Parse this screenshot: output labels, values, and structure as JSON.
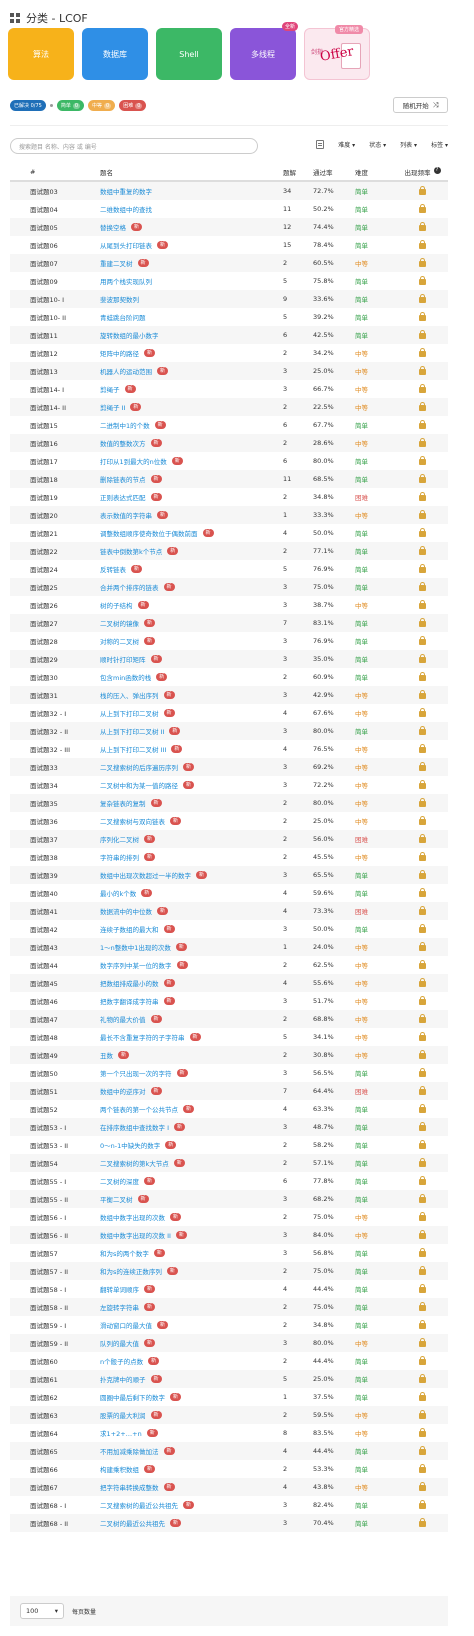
{
  "header": {
    "title": "分类 - LCOF"
  },
  "cards": [
    {
      "label": "算法",
      "color": "#f7b21a",
      "badge": ""
    },
    {
      "label": "数据库",
      "color": "#2f8fe6",
      "badge": ""
    },
    {
      "label": "Shell",
      "color": "#3cb866",
      "badge": ""
    },
    {
      "label": "多线程",
      "color": "#8a55d9",
      "badge": "全新"
    }
  ],
  "offer_card": {
    "tag": "官方精选",
    "text": "Offer",
    "sub": "剑指"
  },
  "status": {
    "solved": {
      "label": "已解决 0/75",
      "color": "#1f6fb8"
    },
    "easy": {
      "label": "简单",
      "count": "0",
      "color": "#3cb866"
    },
    "medium": {
      "label": "中等",
      "count": "0",
      "color": "#f0ad4e"
    },
    "hard": {
      "label": "困难",
      "count": "0",
      "color": "#d9534f"
    }
  },
  "random_button": {
    "label": "随机开始",
    "icon": "shuffle-icon"
  },
  "search": {
    "placeholder": "搜索题目 名称、内容 或 编号"
  },
  "filters": [
    "难度",
    "状态",
    "列表",
    "标签"
  ],
  "columns": {
    "num": "#",
    "title": "题名",
    "solutions": "题解",
    "acceptance": "通过率",
    "difficulty": "难度",
    "frequency": "出现频率"
  },
  "new_badge": "新",
  "rows": [
    {
      "id": "面试题03",
      "title": "数组中重复的数字",
      "new": false,
      "sol": "34",
      "rate": "72.7%",
      "diff": "简单"
    },
    {
      "id": "面试题04",
      "title": "二维数组中的查找",
      "new": false,
      "sol": "11",
      "rate": "50.2%",
      "diff": "简单"
    },
    {
      "id": "面试题05",
      "title": "替换空格",
      "new": true,
      "sol": "12",
      "rate": "74.4%",
      "diff": "简单"
    },
    {
      "id": "面试题06",
      "title": "从尾到头打印链表",
      "new": true,
      "sol": "15",
      "rate": "78.4%",
      "diff": "简单"
    },
    {
      "id": "面试题07",
      "title": "重建二叉树",
      "new": true,
      "sol": "2",
      "rate": "60.5%",
      "diff": "中等"
    },
    {
      "id": "面试题09",
      "title": "用两个栈实现队列",
      "new": false,
      "sol": "5",
      "rate": "75.8%",
      "diff": "简单"
    },
    {
      "id": "面试题10- I",
      "title": "斐波那契数列",
      "new": false,
      "sol": "9",
      "rate": "33.6%",
      "diff": "简单"
    },
    {
      "id": "面试题10- II",
      "title": "青蛙跳台阶问题",
      "new": false,
      "sol": "5",
      "rate": "39.2%",
      "diff": "简单"
    },
    {
      "id": "面试题11",
      "title": "旋转数组的最小数字",
      "new": false,
      "sol": "6",
      "rate": "42.5%",
      "diff": "简单"
    },
    {
      "id": "面试题12",
      "title": "矩阵中的路径",
      "new": true,
      "sol": "2",
      "rate": "34.2%",
      "diff": "中等"
    },
    {
      "id": "面试题13",
      "title": "机器人的运动范围",
      "new": true,
      "sol": "3",
      "rate": "25.0%",
      "diff": "中等"
    },
    {
      "id": "面试题14- I",
      "title": "剪绳子",
      "new": true,
      "sol": "3",
      "rate": "66.7%",
      "diff": "中等"
    },
    {
      "id": "面试题14- II",
      "title": "剪绳子 II",
      "new": true,
      "sol": "2",
      "rate": "22.5%",
      "diff": "中等"
    },
    {
      "id": "面试题15",
      "title": "二进制中1的个数",
      "new": true,
      "sol": "6",
      "rate": "67.7%",
      "diff": "简单"
    },
    {
      "id": "面试题16",
      "title": "数值的整数次方",
      "new": true,
      "sol": "2",
      "rate": "28.6%",
      "diff": "中等"
    },
    {
      "id": "面试题17",
      "title": "打印从1到最大的n位数",
      "new": true,
      "sol": "6",
      "rate": "80.0%",
      "diff": "简单"
    },
    {
      "id": "面试题18",
      "title": "删除链表的节点",
      "new": true,
      "sol": "11",
      "rate": "68.5%",
      "diff": "简单"
    },
    {
      "id": "面试题19",
      "title": "正则表达式匹配",
      "new": true,
      "sol": "2",
      "rate": "34.8%",
      "diff": "困难"
    },
    {
      "id": "面试题20",
      "title": "表示数值的字符串",
      "new": true,
      "sol": "1",
      "rate": "33.3%",
      "diff": "中等"
    },
    {
      "id": "面试题21",
      "title": "调整数组顺序使奇数位于偶数前面",
      "new": true,
      "sol": "4",
      "rate": "50.0%",
      "diff": "简单"
    },
    {
      "id": "面试题22",
      "title": "链表中倒数第k个节点",
      "new": true,
      "sol": "2",
      "rate": "77.1%",
      "diff": "简单"
    },
    {
      "id": "面试题24",
      "title": "反转链表",
      "new": true,
      "sol": "5",
      "rate": "76.9%",
      "diff": "简单"
    },
    {
      "id": "面试题25",
      "title": "合并两个排序的链表",
      "new": true,
      "sol": "3",
      "rate": "75.0%",
      "diff": "简单"
    },
    {
      "id": "面试题26",
      "title": "树的子结构",
      "new": true,
      "sol": "3",
      "rate": "38.7%",
      "diff": "中等"
    },
    {
      "id": "面试题27",
      "title": "二叉树的镜像",
      "new": true,
      "sol": "7",
      "rate": "83.1%",
      "diff": "简单"
    },
    {
      "id": "面试题28",
      "title": "对称的二叉树",
      "new": true,
      "sol": "3",
      "rate": "76.9%",
      "diff": "简单"
    },
    {
      "id": "面试题29",
      "title": "顺时针打印矩阵",
      "new": true,
      "sol": "3",
      "rate": "35.0%",
      "diff": "简单"
    },
    {
      "id": "面试题30",
      "title": "包含min函数的栈",
      "new": true,
      "sol": "2",
      "rate": "60.9%",
      "diff": "简单"
    },
    {
      "id": "面试题31",
      "title": "栈的压入、弹出序列",
      "new": true,
      "sol": "3",
      "rate": "42.9%",
      "diff": "中等"
    },
    {
      "id": "面试题32 - I",
      "title": "从上到下打印二叉树",
      "new": true,
      "sol": "4",
      "rate": "67.6%",
      "diff": "中等"
    },
    {
      "id": "面试题32 - II",
      "title": "从上到下打印二叉树 II",
      "new": true,
      "sol": "3",
      "rate": "80.0%",
      "diff": "简单"
    },
    {
      "id": "面试题32 - III",
      "title": "从上到下打印二叉树 III",
      "new": true,
      "sol": "4",
      "rate": "76.5%",
      "diff": "中等"
    },
    {
      "id": "面试题33",
      "title": "二叉搜索树的后序遍历序列",
      "new": true,
      "sol": "3",
      "rate": "69.2%",
      "diff": "中等"
    },
    {
      "id": "面试题34",
      "title": "二叉树中和为某一值的路径",
      "new": true,
      "sol": "3",
      "rate": "72.2%",
      "diff": "中等"
    },
    {
      "id": "面试题35",
      "title": "复杂链表的复制",
      "new": true,
      "sol": "2",
      "rate": "80.0%",
      "diff": "中等"
    },
    {
      "id": "面试题36",
      "title": "二叉搜索树与双向链表",
      "new": true,
      "sol": "2",
      "rate": "25.0%",
      "diff": "中等"
    },
    {
      "id": "面试题37",
      "title": "序列化二叉树",
      "new": true,
      "sol": "2",
      "rate": "56.0%",
      "diff": "困难"
    },
    {
      "id": "面试题38",
      "title": "字符串的排列",
      "new": true,
      "sol": "2",
      "rate": "45.5%",
      "diff": "中等"
    },
    {
      "id": "面试题39",
      "title": "数组中出现次数超过一半的数字",
      "new": true,
      "sol": "3",
      "rate": "65.5%",
      "diff": "简单"
    },
    {
      "id": "面试题40",
      "title": "最小的k个数",
      "new": true,
      "sol": "4",
      "rate": "59.6%",
      "diff": "简单"
    },
    {
      "id": "面试题41",
      "title": "数据流中的中位数",
      "new": true,
      "sol": "4",
      "rate": "73.3%",
      "diff": "困难"
    },
    {
      "id": "面试题42",
      "title": "连续子数组的最大和",
      "new": true,
      "sol": "3",
      "rate": "50.0%",
      "diff": "简单"
    },
    {
      "id": "面试题43",
      "title": "1～n整数中1出现的次数",
      "new": true,
      "sol": "1",
      "rate": "24.0%",
      "diff": "中等"
    },
    {
      "id": "面试题44",
      "title": "数字序列中某一位的数字",
      "new": true,
      "sol": "2",
      "rate": "62.5%",
      "diff": "中等"
    },
    {
      "id": "面试题45",
      "title": "把数组排成最小的数",
      "new": true,
      "sol": "4",
      "rate": "55.6%",
      "diff": "中等"
    },
    {
      "id": "面试题46",
      "title": "把数字翻译成字符串",
      "new": true,
      "sol": "3",
      "rate": "51.7%",
      "diff": "中等"
    },
    {
      "id": "面试题47",
      "title": "礼物的最大价值",
      "new": true,
      "sol": "2",
      "rate": "68.8%",
      "diff": "中等"
    },
    {
      "id": "面试题48",
      "title": "最长不含重复字符的子字符串",
      "new": true,
      "sol": "5",
      "rate": "34.1%",
      "diff": "中等"
    },
    {
      "id": "面试题49",
      "title": "丑数",
      "new": true,
      "sol": "2",
      "rate": "30.8%",
      "diff": "中等"
    },
    {
      "id": "面试题50",
      "title": "第一个只出现一次的字符",
      "new": true,
      "sol": "3",
      "rate": "56.5%",
      "diff": "简单"
    },
    {
      "id": "面试题51",
      "title": "数组中的逆序对",
      "new": true,
      "sol": "7",
      "rate": "64.4%",
      "diff": "困难"
    },
    {
      "id": "面试题52",
      "title": "两个链表的第一个公共节点",
      "new": true,
      "sol": "4",
      "rate": "63.3%",
      "diff": "简单"
    },
    {
      "id": "面试题53 - I",
      "title": "在排序数组中查找数字 I",
      "new": true,
      "sol": "3",
      "rate": "48.7%",
      "diff": "简单"
    },
    {
      "id": "面试题53 - II",
      "title": "0～n-1中缺失的数字",
      "new": true,
      "sol": "2",
      "rate": "58.2%",
      "diff": "简单"
    },
    {
      "id": "面试题54",
      "title": "二叉搜索树的第k大节点",
      "new": true,
      "sol": "2",
      "rate": "57.1%",
      "diff": "简单"
    },
    {
      "id": "面试题55 - I",
      "title": "二叉树的深度",
      "new": true,
      "sol": "6",
      "rate": "77.8%",
      "diff": "简单"
    },
    {
      "id": "面试题55 - II",
      "title": "平衡二叉树",
      "new": true,
      "sol": "3",
      "rate": "68.2%",
      "diff": "简单"
    },
    {
      "id": "面试题56 - I",
      "title": "数组中数字出现的次数",
      "new": true,
      "sol": "2",
      "rate": "75.0%",
      "diff": "中等"
    },
    {
      "id": "面试题56 - II",
      "title": "数组中数字出现的次数 II",
      "new": true,
      "sol": "3",
      "rate": "84.0%",
      "diff": "中等"
    },
    {
      "id": "面试题57",
      "title": "和为s的两个数字",
      "new": true,
      "sol": "3",
      "rate": "56.8%",
      "diff": "简单"
    },
    {
      "id": "面试题57 - II",
      "title": "和为s的连续正数序列",
      "new": true,
      "sol": "2",
      "rate": "75.0%",
      "diff": "简单"
    },
    {
      "id": "面试题58 - I",
      "title": "翻转单词顺序",
      "new": true,
      "sol": "4",
      "rate": "44.4%",
      "diff": "简单"
    },
    {
      "id": "面试题58 - II",
      "title": "左旋转字符串",
      "new": true,
      "sol": "2",
      "rate": "75.0%",
      "diff": "简单"
    },
    {
      "id": "面试题59 - I",
      "title": "滑动窗口的最大值",
      "new": true,
      "sol": "2",
      "rate": "34.8%",
      "diff": "简单"
    },
    {
      "id": "面试题59 - II",
      "title": "队列的最大值",
      "new": true,
      "sol": "3",
      "rate": "80.0%",
      "diff": "中等"
    },
    {
      "id": "面试题60",
      "title": "n个骰子的点数",
      "new": true,
      "sol": "2",
      "rate": "44.4%",
      "diff": "简单"
    },
    {
      "id": "面试题61",
      "title": "扑克牌中的顺子",
      "new": true,
      "sol": "5",
      "rate": "25.0%",
      "diff": "简单"
    },
    {
      "id": "面试题62",
      "title": "圆圈中最后剩下的数字",
      "new": true,
      "sol": "1",
      "rate": "37.5%",
      "diff": "简单"
    },
    {
      "id": "面试题63",
      "title": "股票的最大利润",
      "new": true,
      "sol": "2",
      "rate": "59.5%",
      "diff": "中等"
    },
    {
      "id": "面试题64",
      "title": "求1+2+…+n",
      "new": true,
      "sol": "8",
      "rate": "83.5%",
      "diff": "中等"
    },
    {
      "id": "面试题65",
      "title": "不用加减乘除做加法",
      "new": true,
      "sol": "4",
      "rate": "44.4%",
      "diff": "简单"
    },
    {
      "id": "面试题66",
      "title": "构建乘积数组",
      "new": true,
      "sol": "2",
      "rate": "53.3%",
      "diff": "简单"
    },
    {
      "id": "面试题67",
      "title": "把字符串转换成整数",
      "new": true,
      "sol": "4",
      "rate": "43.8%",
      "diff": "中等"
    },
    {
      "id": "面试题68 - I",
      "title": "二叉搜索树的最近公共祖先",
      "new": true,
      "sol": "3",
      "rate": "82.4%",
      "diff": "简单"
    },
    {
      "id": "面试题68 - II",
      "title": "二叉树的最近公共祖先",
      "new": true,
      "sol": "3",
      "rate": "70.4%",
      "diff": "简单"
    }
  ],
  "pagination": {
    "page_size": "100",
    "label": "每页数量"
  }
}
